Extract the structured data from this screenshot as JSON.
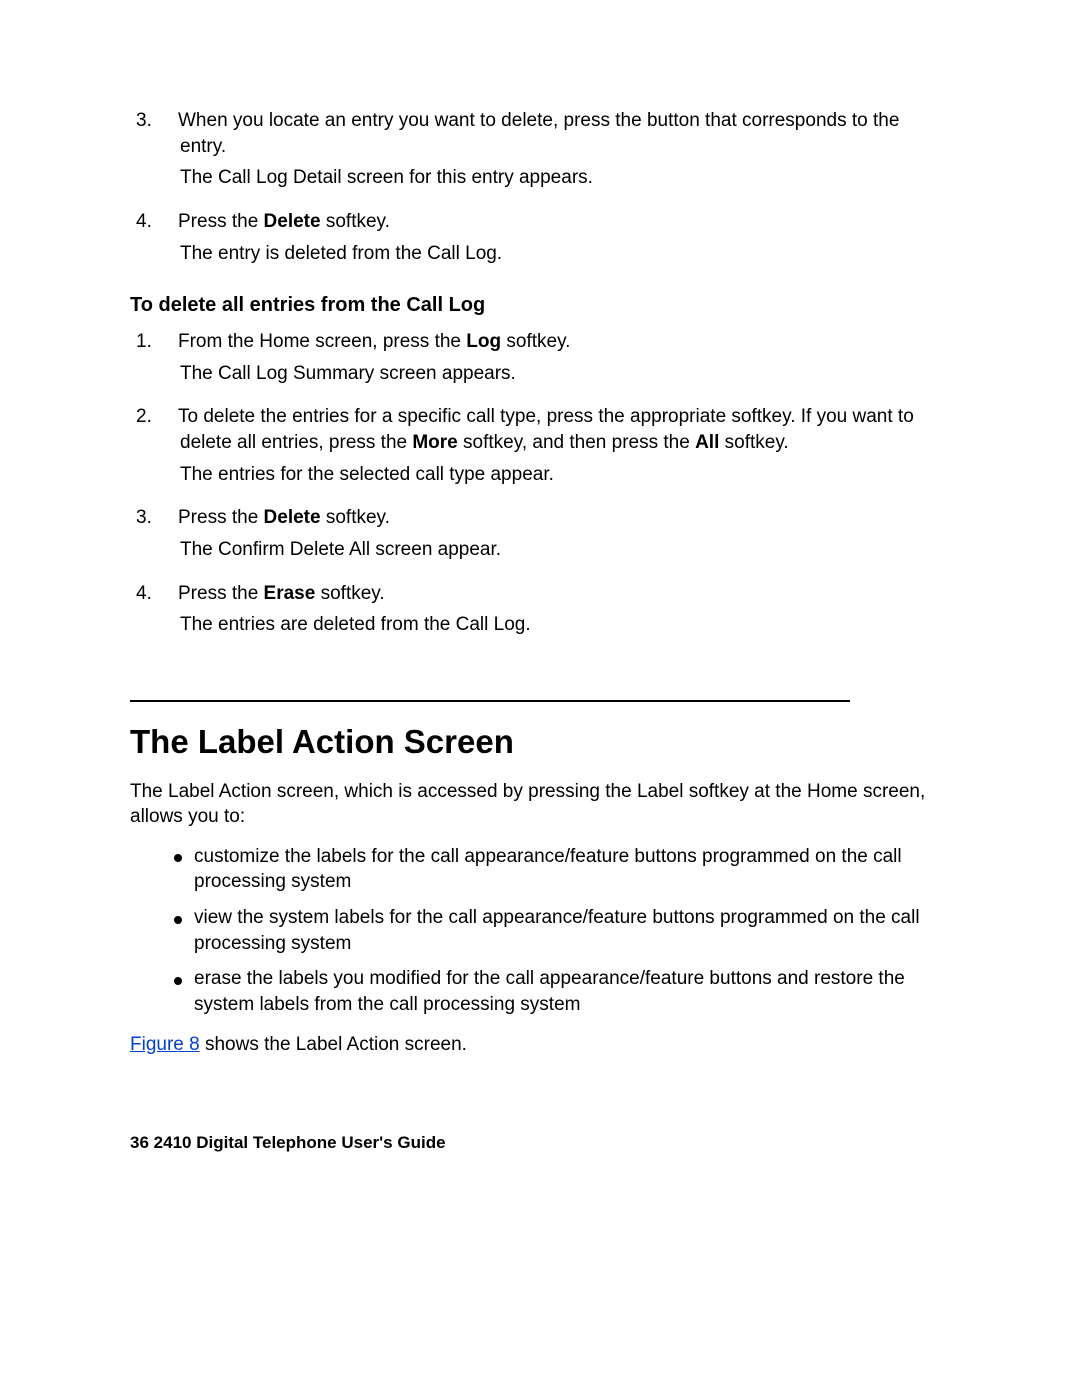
{
  "top_list": {
    "item3": {
      "num": "3.",
      "text_parts": [
        "When you locate an entry you want to delete, press the button that corresponds to the entry."
      ],
      "follow": "The Call Log Detail screen for this entry appears."
    },
    "item4": {
      "num": "4.",
      "pre": "Press the ",
      "bold": "Delete",
      "post": " softkey.",
      "follow": "The entry is deleted from the Call Log."
    }
  },
  "subhead": "To delete all entries from the Call Log",
  "del_all": {
    "s1": {
      "num": "1.",
      "pre": "From the Home screen, press the ",
      "bold": "Log",
      "post": " softkey.",
      "follow": "The Call Log Summary screen appears."
    },
    "s2": {
      "num": "2.",
      "pre": "To delete the entries for a specific call type, press the appropriate softkey. If you want to delete all entries, press the ",
      "bold1": "More",
      "mid": " softkey, and then press the ",
      "bold2": "All",
      "post": " softkey.",
      "follow": "The entries for the selected call type appear."
    },
    "s3": {
      "num": "3.",
      "pre": "Press the ",
      "bold": "Delete",
      "post": " softkey.",
      "follow": "The Confirm Delete All screen appear."
    },
    "s4": {
      "num": "4.",
      "pre": "Press the ",
      "bold": "Erase",
      "post": " softkey.",
      "follow": "The entries are deleted from the Call Log."
    }
  },
  "section": {
    "title": "The Label Action Screen",
    "intro": "The Label Action screen, which is accessed by pressing the Label softkey at the Home screen, allows you to:",
    "bullets": {
      "b1": "customize the labels for the call appearance/feature buttons programmed on the call processing system",
      "b2": "view the system labels for the call appearance/feature buttons programmed on the call processing system",
      "b3": "erase the labels you modified for the call appearance/feature buttons and restore the system labels from the call processing system"
    },
    "fig_link": "Figure 8",
    "fig_tail": " shows the Label Action screen."
  },
  "footer": {
    "page": "36",
    "sep": "   ",
    "title": "2410 Digital Telephone User's Guide"
  }
}
